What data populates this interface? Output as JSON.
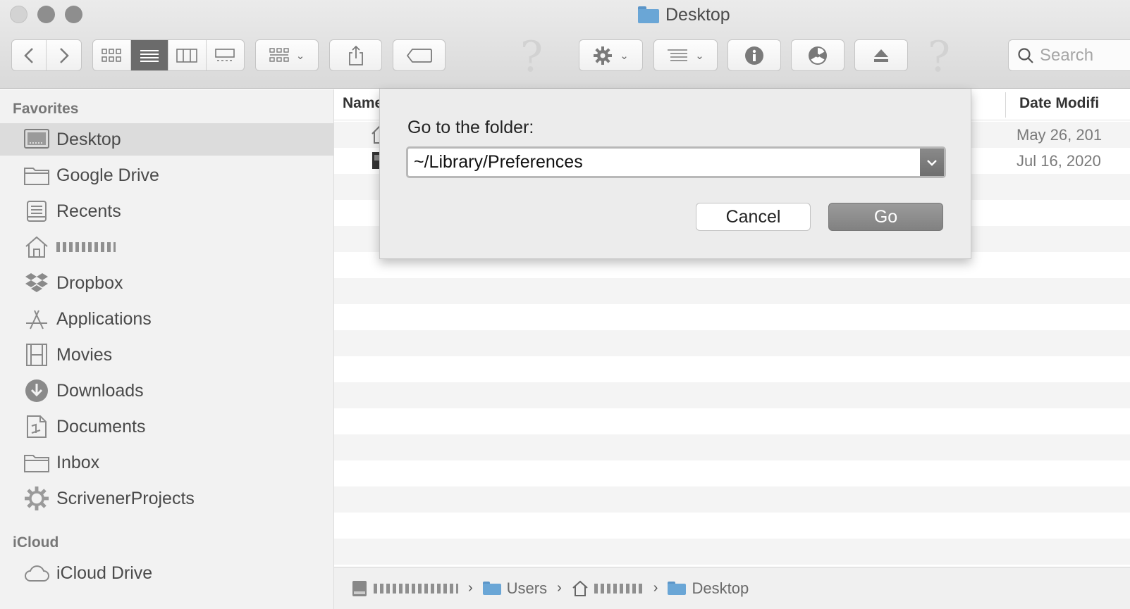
{
  "window": {
    "title": "Desktop"
  },
  "toolbar": {
    "search_placeholder": "Search",
    "icons": [
      "back-icon",
      "forward-icon",
      "icon-view-icon",
      "list-view-icon",
      "column-view-icon",
      "gallery-view-icon",
      "group-icon",
      "share-icon",
      "tag-icon",
      "help-icon",
      "gear-icon",
      "arrange-icon",
      "info-icon",
      "burn-icon",
      "eject-icon",
      "help-icon",
      "search-icon"
    ]
  },
  "sidebar": {
    "favorites_heading": "Favorites",
    "favorites": [
      {
        "label": "Desktop",
        "icon": "desktop-icon",
        "selected": true
      },
      {
        "label": "Google Drive",
        "icon": "folder-icon"
      },
      {
        "label": "Recents",
        "icon": "recents-icon"
      },
      {
        "label": "",
        "icon": "home-icon"
      },
      {
        "label": "Dropbox",
        "icon": "dropbox-icon"
      },
      {
        "label": "Applications",
        "icon": "applications-icon"
      },
      {
        "label": "Movies",
        "icon": "movies-icon"
      },
      {
        "label": "Downloads",
        "icon": "downloads-icon"
      },
      {
        "label": "Documents",
        "icon": "documents-icon"
      },
      {
        "label": "Inbox",
        "icon": "folder-icon"
      },
      {
        "label": "ScrivenerProjects",
        "icon": "gear-icon"
      }
    ],
    "icloud_heading": "iCloud",
    "icloud": [
      {
        "label": "iCloud Drive",
        "icon": "cloud-icon"
      }
    ]
  },
  "list": {
    "col_name": "Name",
    "col_date": "Date Modifi",
    "rows": [
      {
        "date": "May 26, 201"
      },
      {
        "date": "Jul 16, 2020"
      }
    ]
  },
  "pathbar": {
    "crumbs": [
      "",
      "Users",
      "",
      "Desktop"
    ]
  },
  "dialog": {
    "label": "Go to the folder:",
    "value": "~/Library/Preferences",
    "cancel_label": "Cancel",
    "go_label": "Go"
  },
  "colors": {
    "folder_blue": "#6aa6d6",
    "go_button": "#8e8e8e",
    "selected_row": "#dcdcdc"
  }
}
